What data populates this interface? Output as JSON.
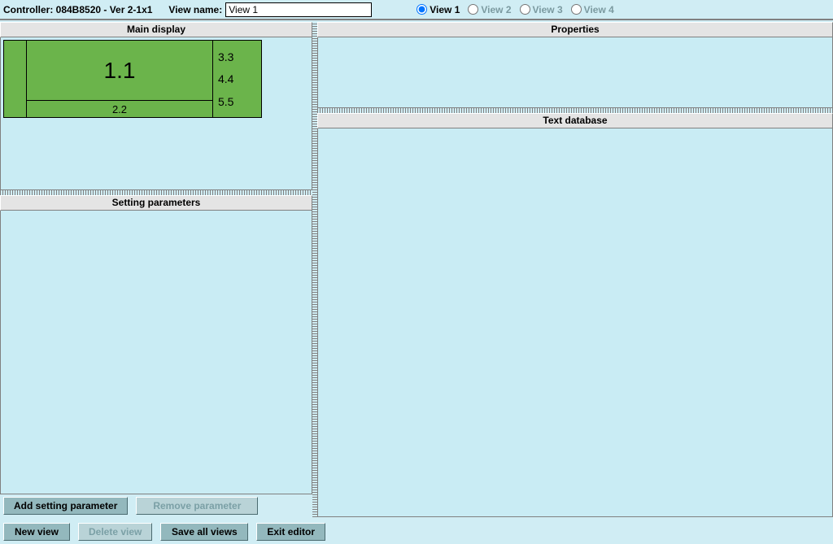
{
  "header": {
    "controller_label": "Controller: 084B8520 - Ver 2-1x1",
    "viewname_label": "View name:",
    "viewname_value": "View 1",
    "views": [
      {
        "label": "View 1",
        "selected": true
      },
      {
        "label": "View 2",
        "selected": false
      },
      {
        "label": "View 3",
        "selected": false
      },
      {
        "label": "View 4",
        "selected": false
      }
    ]
  },
  "panels": {
    "main_display": "Main display",
    "setting_parameters": "Setting parameters",
    "properties": "Properties",
    "text_database": "Text database"
  },
  "display_widget": {
    "center": "1.1",
    "bottom": "2.2",
    "right": [
      "3.3",
      "4.4",
      "5.5"
    ]
  },
  "buttons": {
    "add_setting_parameter": "Add setting parameter",
    "remove_parameter": "Remove parameter",
    "new_view": "New view",
    "delete_view": "Delete view",
    "save_all_views": "Save all views",
    "exit_editor": "Exit editor"
  }
}
